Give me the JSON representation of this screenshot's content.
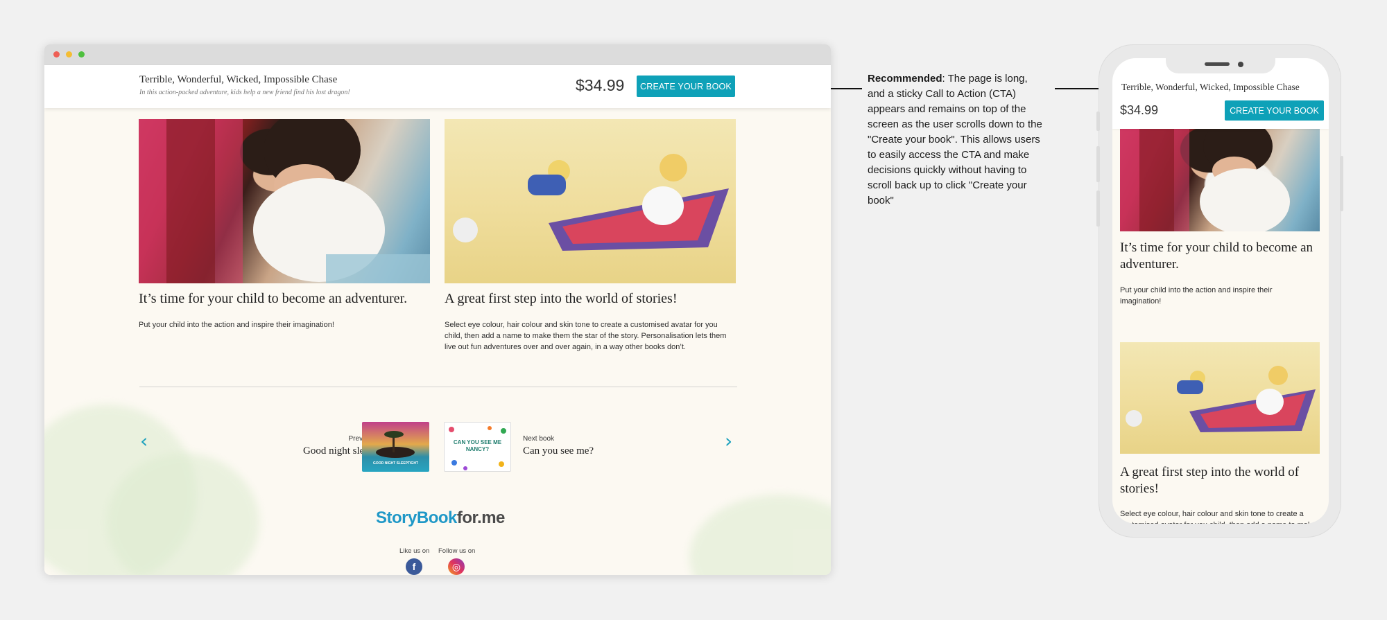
{
  "desktop": {
    "header": {
      "book_title": "Terrible, Wonderful, Wicked, Impossible Chase",
      "book_subtitle": "In this action-packed adventure, kids help a new friend find his lost dragon!",
      "price": "$34.99",
      "cta_label": "CREATE YOUR BOOK"
    },
    "features": [
      {
        "heading": "It’s time for your child to become an adventurer.",
        "body": "Put your child into the action and inspire their imagination!"
      },
      {
        "heading": "A great first step into the world of stories!",
        "body": "Select eye colour, hair colour and skin tone to create a customised avatar for you child, then add a name to make them the star of the story. Personalisation lets them live out fun adventures over and over again, in a way other books don’t."
      }
    ],
    "book_nav": {
      "previous_label": "Previous Book",
      "previous_title": "Good night sleeptight",
      "previous_thumb_text": "GOOD NIGHT SLEEPTIGHT",
      "next_label": "Next book",
      "next_title": "Can you see me?",
      "next_thumb_text": "CAN YOU SEE ME NANCY?"
    },
    "footer": {
      "logo_part1": "Story",
      "logo_part2": "Book",
      "logo_part3": "for.me",
      "like_label": "Like us on",
      "follow_label": "Follow us on"
    }
  },
  "annotation": {
    "bold": "Recommended",
    "text": ": The page is long, and a sticky Call to Action (CTA) appears and remains on top of the screen as the user scrolls down to the \"Create your book\". This allows users to easily access the CTA and make decisions quickly without having to scroll back up to click \"Create your book\""
  },
  "mobile": {
    "book_title": "Terrible, Wonderful, Wicked, Impossible Chase",
    "price": "$34.99",
    "cta_label": "CREATE YOUR BOOK",
    "feature1_heading": "It’s time for your child to become an adventurer.",
    "feature1_body": "Put your child into the action and inspire their imagination!",
    "feature2_heading": "A great first step into the world of stories!",
    "feature2_body": "Select eye colour, hair colour and skin tone to create a customised avatar for you child, then add a name to make them"
  },
  "colors": {
    "accent": "#0ea1b8",
    "page_background": "#fcf9f2",
    "canvas_background": "#f1f1f1"
  }
}
